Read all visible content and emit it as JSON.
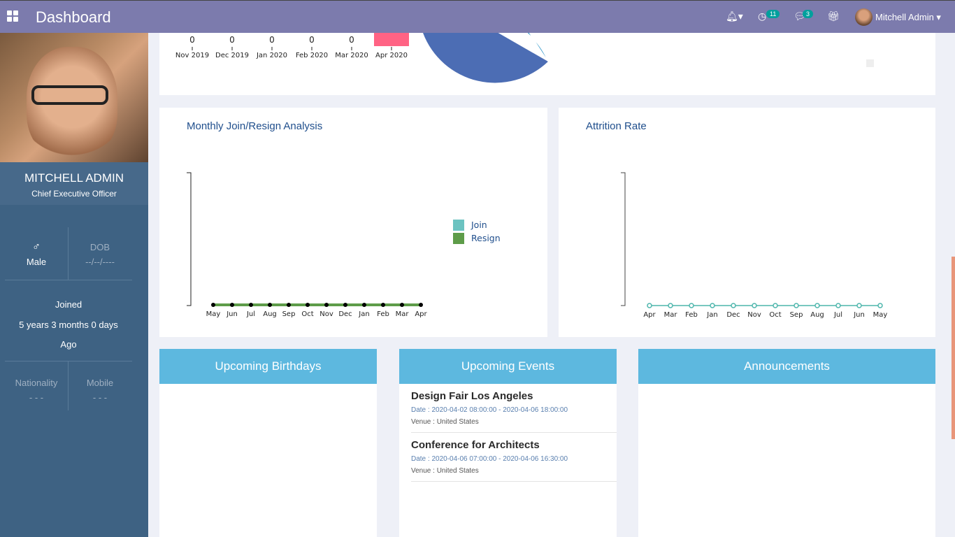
{
  "nav": {
    "title": "Dashboard",
    "activity_count": "11",
    "message_count": "3",
    "user": "Mitchell Admin",
    "icons": [
      "apps-icon",
      "bell-icon",
      "clock-icon",
      "chat-icon",
      "gift-icon"
    ]
  },
  "profile": {
    "name": "MITCHELL ADMIN",
    "role": "Chief Executive Officer",
    "gender_icon": "male-icon",
    "gender": "Male",
    "dob_label": "DOB",
    "dob": "--/--/----",
    "joined_label": "Joined",
    "joined_duration": "5 years 3 months 0 days",
    "joined_suffix": "Ago",
    "nationality_label": "Nationality",
    "nationality": "- - -",
    "mobile_label": "Mobile",
    "mobile": "- - -"
  },
  "chart_data": [
    {
      "type": "bar",
      "categories": [
        "Nov 2019",
        "Dec 2019",
        "Jan 2020",
        "Feb 2020",
        "Mar 2020",
        "Apr 2020"
      ],
      "values": [
        0,
        0,
        0,
        0,
        0,
        null
      ],
      "data_labels": [
        "0",
        "0",
        "0",
        "0",
        "0",
        ""
      ],
      "colors": {
        "Apr 2020": "#ff6384"
      }
    },
    {
      "type": "pie",
      "colors": [
        "#4c6db4",
        "#2391c6"
      ]
    },
    {
      "type": "line",
      "title": "Monthly Join/Resign Analysis",
      "categories": [
        "May",
        "Jun",
        "Jul",
        "Aug",
        "Sep",
        "Oct",
        "Nov",
        "Dec",
        "Jan",
        "Feb",
        "Mar",
        "Apr"
      ],
      "series": [
        {
          "name": "Join",
          "values": [
            0,
            0,
            0,
            0,
            0,
            0,
            0,
            0,
            0,
            0,
            0,
            0
          ],
          "color": "#6cc3c1"
        },
        {
          "name": "Resign",
          "values": [
            0,
            0,
            0,
            0,
            0,
            0,
            0,
            0,
            0,
            0,
            0,
            0
          ],
          "color": "#5e9c49"
        }
      ],
      "legend": "right"
    },
    {
      "type": "line",
      "title": "Attrition Rate",
      "categories": [
        "Apr",
        "Mar",
        "Feb",
        "Jan",
        "Dec",
        "Nov",
        "Oct",
        "Sep",
        "Aug",
        "Jul",
        "Jun",
        "May"
      ],
      "series": [
        {
          "values": [
            0,
            0,
            0,
            0,
            0,
            0,
            0,
            0,
            0,
            0,
            0,
            0
          ],
          "color": "#4db6ac"
        }
      ]
    }
  ],
  "panels": {
    "birthdays": "Upcoming Birthdays",
    "events": "Upcoming Events",
    "announcements": "Announcements"
  },
  "events": [
    {
      "title": "Design Fair Los Angeles",
      "date": "Date : 2020-04-02 08:00:00 - 2020-04-06 18:00:00",
      "venue": "Venue : United States"
    },
    {
      "title": "Conference for Architects",
      "date": "Date : 2020-04-06 07:00:00 - 2020-04-06 16:30:00",
      "venue": "Venue : United States"
    }
  ]
}
